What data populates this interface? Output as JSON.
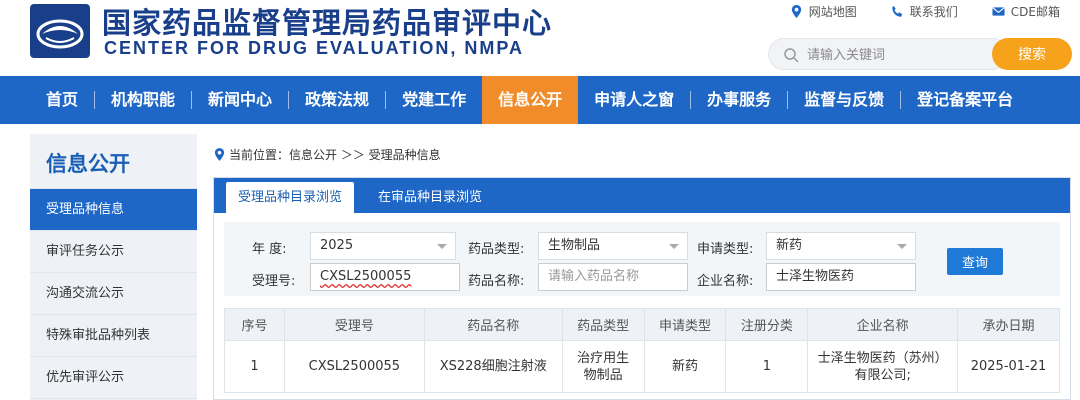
{
  "header": {
    "title_cn": "国家药品监督管理局药品审评中心",
    "title_en": "CENTER FOR DRUG EVALUATION, NMPA",
    "toplinks": [
      {
        "label": "网站地图",
        "icon": "map-pin-icon"
      },
      {
        "label": "联系我们",
        "icon": "phone-icon"
      },
      {
        "label": "CDE邮箱",
        "icon": "mail-icon"
      }
    ],
    "search": {
      "placeholder": "请输入关键词",
      "button_label": "搜索"
    }
  },
  "nav": {
    "items": [
      {
        "label": "首页"
      },
      {
        "label": "机构职能"
      },
      {
        "label": "新闻中心"
      },
      {
        "label": "政策法规"
      },
      {
        "label": "党建工作"
      },
      {
        "label": "信息公开",
        "active": true
      },
      {
        "label": "申请人之窗"
      },
      {
        "label": "办事服务"
      },
      {
        "label": "监督与反馈"
      },
      {
        "label": "登记备案平台"
      }
    ]
  },
  "sidebar": {
    "title": "信息公开",
    "items": [
      {
        "label": "受理品种信息",
        "active": true
      },
      {
        "label": "审评任务公示"
      },
      {
        "label": "沟通交流公示"
      },
      {
        "label": "特殊审批品种列表"
      },
      {
        "label": "优先审评公示"
      }
    ]
  },
  "breadcrumb": {
    "text": "当前位置：信息公开 ＞＞ 受理品种信息"
  },
  "tabs": [
    {
      "label": "受理品种目录浏览",
      "active": true
    },
    {
      "label": "在审品种目录浏览"
    }
  ],
  "form": {
    "year_label": "年    度:",
    "year_value": "2025",
    "drug_type_label": "药品类型:",
    "drug_type_value": "生物制品",
    "apply_type_label": "申请类型:",
    "apply_type_value": "新药",
    "accept_no_label": "受理号:",
    "accept_no_value": "CXSL2500055",
    "drug_name_label": "药品名称:",
    "drug_name_placeholder": "请输入药品名称",
    "company_label": "企业名称:",
    "company_value": "士泽生物医药",
    "query_button": "查询"
  },
  "table": {
    "headers": [
      "序号",
      "受理号",
      "药品名称",
      "药品类型",
      "申请类型",
      "注册分类",
      "企业名称",
      "承办日期"
    ],
    "rows": [
      {
        "index": "1",
        "accept_no": "CXSL2500055",
        "drug_name": "XS228细胞注射液",
        "drug_type_line1": "治疗用生",
        "drug_type_line2": "物制品",
        "apply_type": "新药",
        "reg_class": "1",
        "company_line1": "士泽生物医药（苏州）",
        "company_line2": "有限公司;",
        "date": "2025-01-21"
      }
    ]
  },
  "colors": {
    "brand_blue": "#1e67c6",
    "title_blue": "#1a3f8a",
    "accent_orange": "#f7a21b"
  }
}
